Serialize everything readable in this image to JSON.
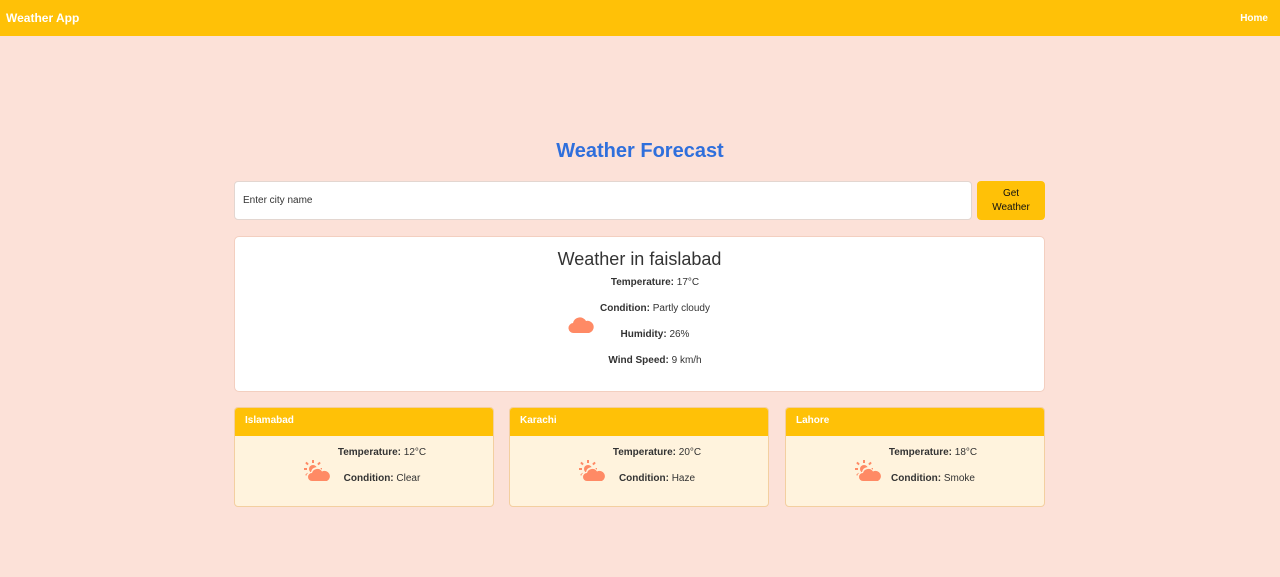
{
  "nav": {
    "brand": "Weather App",
    "home": "Home"
  },
  "page_title": "Weather Forecast",
  "search": {
    "placeholder": "Enter city name",
    "value": ""
  },
  "button": {
    "label": "Get Weather"
  },
  "current": {
    "heading": "Weather in faislabad",
    "icon": "cloud-icon",
    "temperature_label": "Temperature:",
    "temperature": "17°C",
    "condition_label": "Condition:",
    "condition": "Partly cloudy",
    "humidity_label": "Humidity:",
    "humidity": "26%",
    "wind_label": "Wind Speed:",
    "wind": "9 km/h"
  },
  "cities": [
    {
      "name": "Islamabad",
      "temperature_label": "Temperature:",
      "temperature": "12°C",
      "condition_label": "Condition:",
      "condition": "Clear",
      "icon": "sun-behind-cloud-icon"
    },
    {
      "name": "Karachi",
      "temperature_label": "Temperature:",
      "temperature": "20°C",
      "condition_label": "Condition:",
      "condition": "Haze",
      "icon": "sun-behind-cloud-icon"
    },
    {
      "name": "Lahore",
      "temperature_label": "Temperature:",
      "temperature": "18°C",
      "condition_label": "Condition:",
      "condition": "Smoke",
      "icon": "sun-behind-cloud-icon"
    }
  ],
  "colors": {
    "accent": "#ffc107",
    "background": "#fce1d8",
    "title": "#2f6fdc",
    "icon": "#ff8a65",
    "city_card": "#fff3dd"
  }
}
